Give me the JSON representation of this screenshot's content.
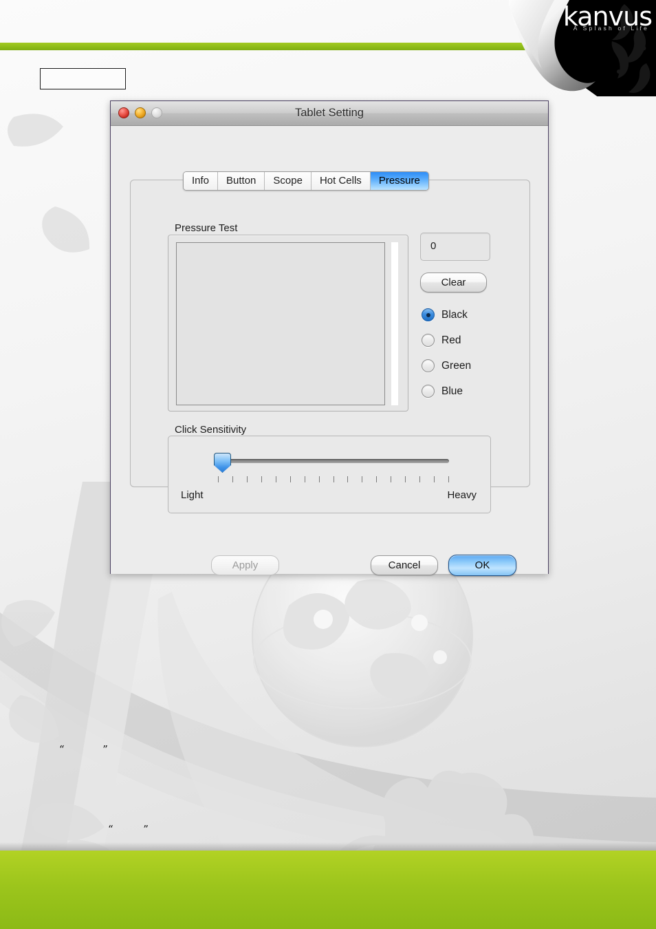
{
  "brand": {
    "logo_text": "kanvus",
    "tagline": "A Splash of Life",
    "green": "#9cc51c",
    "band_green": "#8ebc18"
  },
  "page": {
    "callout_text": "",
    "quote_open": "“",
    "quote_close": "”"
  },
  "dialog": {
    "title": "Tablet Setting",
    "window_controls": {
      "close": "close-button",
      "minimize": "minimize-button",
      "zoom": "zoom-button"
    },
    "tabs": [
      {
        "label": "Info",
        "active": false
      },
      {
        "label": "Button",
        "active": false
      },
      {
        "label": "Scope",
        "active": false
      },
      {
        "label": "Hot Cells",
        "active": false
      },
      {
        "label": "Pressure",
        "active": true
      }
    ],
    "pressure_test": {
      "group_label": "Pressure Test",
      "value": "0",
      "clear_label": "Clear",
      "colors": [
        {
          "label": "Black",
          "hex": "#000000",
          "selected": true
        },
        {
          "label": "Red",
          "hex": "#ff0000",
          "selected": false
        },
        {
          "label": "Green",
          "hex": "#00a000",
          "selected": false
        },
        {
          "label": "Blue",
          "hex": "#0000ff",
          "selected": false
        }
      ]
    },
    "click_sensitivity": {
      "group_label": "Click Sensitivity",
      "min_label": "Light",
      "max_label": "Heavy",
      "tick_count": 17,
      "value_percent": 0
    },
    "buttons": {
      "apply": "Apply",
      "apply_enabled": false,
      "cancel": "Cancel",
      "ok": "OK",
      "ok_default": true
    },
    "accent": "#3f93e8",
    "tab_active_color": "#51a7fb"
  }
}
